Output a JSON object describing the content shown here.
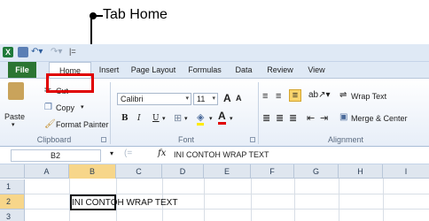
{
  "annotation": {
    "label": "Tab Home"
  },
  "quick_access": {
    "separator": "|="
  },
  "tabs": [
    {
      "label": "File"
    },
    {
      "label": "Home"
    },
    {
      "label": "Insert"
    },
    {
      "label": "Page Layout"
    },
    {
      "label": "Formulas"
    },
    {
      "label": "Data"
    },
    {
      "label": "Review"
    },
    {
      "label": "View"
    }
  ],
  "clipboard": {
    "paste": "Paste",
    "cut": "Cut",
    "copy": "Copy",
    "format_painter": "Format Painter",
    "group_label": "Clipboard"
  },
  "font": {
    "family": "Calibri",
    "size": "11",
    "bold": "B",
    "italic": "I",
    "underline": "U",
    "grow": "A",
    "shrink": "A",
    "color_glyph": "A",
    "group_label": "Font"
  },
  "alignment": {
    "wrap_text": "Wrap Text",
    "merge_center": "Merge & Center",
    "group_label": "Alignment"
  },
  "formula_bar": {
    "name_box": "B2",
    "fx": "fx",
    "value": "INI CONTOH WRAP TEXT"
  },
  "sheet": {
    "columns": [
      "A",
      "B",
      "C",
      "D",
      "E",
      "F",
      "G",
      "H",
      "I"
    ],
    "rows": [
      "1",
      "2",
      "3"
    ],
    "selected_column": "B",
    "selected_row": "2",
    "cell_b2": "INI CONTOH WRAP TEXT"
  },
  "colors": {
    "file_tab": "#2b7533",
    "highlight": "#e00000",
    "selection": "#f7d68a"
  }
}
